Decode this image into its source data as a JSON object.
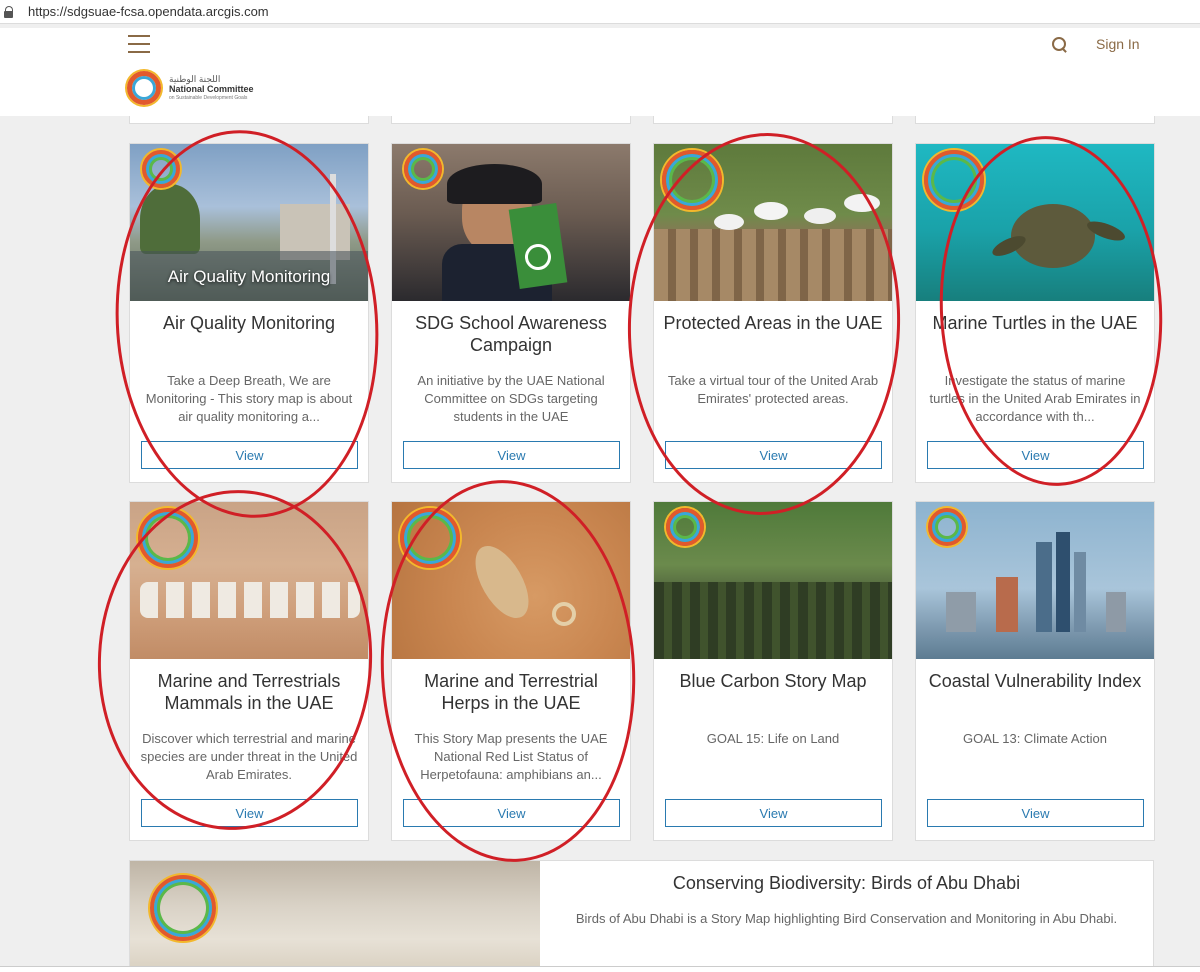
{
  "browser": {
    "url": "https://sdgsuae-fcsa.opendata.arcgis.com"
  },
  "header": {
    "logo_arabic": "اللجنة الوطنية",
    "logo_english": "National Committee",
    "logo_sub": "on Sustainable Development Goals",
    "signin_label": "Sign In"
  },
  "cards": [
    {
      "title": "Air Quality Monitoring",
      "thumb_caption": "Air Quality Monitoring",
      "description": "Take a Deep Breath, We are Monitoring - This story map is about air quality monitoring a...",
      "view_label": "View"
    },
    {
      "title": "SDG School Awareness Campaign",
      "thumb_caption": "",
      "description": "An initiative by the UAE National Committee on SDGs targeting students in the UAE",
      "view_label": "View"
    },
    {
      "title": "Protected Areas in the UAE",
      "thumb_caption": "",
      "description": "Take a virtual tour of the United Arab Emirates' protected areas.",
      "view_label": "View"
    },
    {
      "title": "Marine Turtles in the UAE",
      "thumb_caption": "",
      "description": "Investigate the status of marine turtles in the United Arab Emirates in accordance with th...",
      "view_label": "View"
    },
    {
      "title": "Marine and Terrestrials Mammals in the UAE",
      "thumb_caption": "",
      "description": "Discover which terrestrial and marine species are under threat in the United Arab Emirates.",
      "view_label": "View"
    },
    {
      "title": "Marine and Terrestrial Herps in the UAE",
      "thumb_caption": "",
      "description": "This Story Map presents the UAE National Red List Status of Herpetofauna: amphibians an...",
      "view_label": "View"
    },
    {
      "title": "Blue Carbon Story Map",
      "thumb_caption": "",
      "description": "GOAL 15: Life on Land",
      "view_label": "View"
    },
    {
      "title": "Coastal Vulnerability Index",
      "thumb_caption": "",
      "description": "GOAL 13: Climate Action",
      "view_label": "View"
    }
  ],
  "wide_card": {
    "title": "Conserving Biodiversity: Birds of Abu Dhabi",
    "description": "Birds of Abu Dhabi is a Story Map highlighting Bird Conservation and Monitoring in Abu Dhabi."
  },
  "colors": {
    "accent": "#8a6a46",
    "link": "#2a7ab0",
    "annotation": "#d01f26"
  }
}
